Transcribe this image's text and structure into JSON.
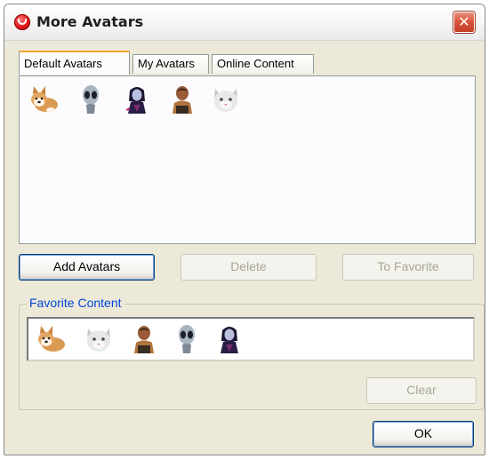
{
  "window": {
    "title": "More Avatars",
    "close_icon": "close-icon"
  },
  "tabs": [
    {
      "label": "Default Avatars",
      "active": true
    },
    {
      "label": "My Avatars",
      "active": false
    },
    {
      "label": "Online Content",
      "active": false
    }
  ],
  "avatars": [
    "corgi-dog-avatar",
    "grey-alien-avatar",
    "dark-elf-avatar",
    "bald-man-avatar",
    "white-cat-avatar"
  ],
  "buttons": {
    "add_avatars": "Add Avatars",
    "delete": "Delete",
    "to_favorite": "To Favorite"
  },
  "favorites": {
    "legend": "Favorite Content",
    "items": [
      "corgi-dog-avatar",
      "white-cat-avatar",
      "bald-man-avatar",
      "grey-alien-avatar",
      "dark-elf-avatar"
    ],
    "clear_label": "Clear"
  },
  "footer": {
    "ok_label": "OK"
  },
  "colors": {
    "tab_accent": "#f3a527",
    "legend_blue": "#0046d5",
    "close_red": "#d9553b"
  }
}
